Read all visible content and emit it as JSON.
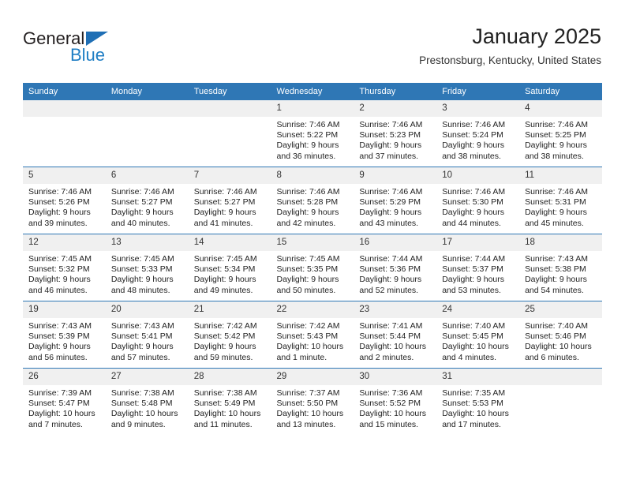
{
  "brand": {
    "name_part1": "General",
    "name_part2": "Blue",
    "logo_icon": "triangle-icon",
    "accent_color": "#1f7ec4"
  },
  "header": {
    "title": "January 2025",
    "subtitle": "Prestonsburg, Kentucky, United States"
  },
  "theme": {
    "header_bar_color": "#2f77b5",
    "daynum_bg": "#f0f0f0",
    "row_divider": "#2f77b5"
  },
  "calendar": {
    "weekday_headers": [
      "Sunday",
      "Monday",
      "Tuesday",
      "Wednesday",
      "Thursday",
      "Friday",
      "Saturday"
    ],
    "weeks": [
      [
        {
          "day": "",
          "sunrise": "",
          "sunset": "",
          "daylight1": "",
          "daylight2": ""
        },
        {
          "day": "",
          "sunrise": "",
          "sunset": "",
          "daylight1": "",
          "daylight2": ""
        },
        {
          "day": "",
          "sunrise": "",
          "sunset": "",
          "daylight1": "",
          "daylight2": ""
        },
        {
          "day": "1",
          "sunrise": "Sunrise: 7:46 AM",
          "sunset": "Sunset: 5:22 PM",
          "daylight1": "Daylight: 9 hours",
          "daylight2": "and 36 minutes."
        },
        {
          "day": "2",
          "sunrise": "Sunrise: 7:46 AM",
          "sunset": "Sunset: 5:23 PM",
          "daylight1": "Daylight: 9 hours",
          "daylight2": "and 37 minutes."
        },
        {
          "day": "3",
          "sunrise": "Sunrise: 7:46 AM",
          "sunset": "Sunset: 5:24 PM",
          "daylight1": "Daylight: 9 hours",
          "daylight2": "and 38 minutes."
        },
        {
          "day": "4",
          "sunrise": "Sunrise: 7:46 AM",
          "sunset": "Sunset: 5:25 PM",
          "daylight1": "Daylight: 9 hours",
          "daylight2": "and 38 minutes."
        }
      ],
      [
        {
          "day": "5",
          "sunrise": "Sunrise: 7:46 AM",
          "sunset": "Sunset: 5:26 PM",
          "daylight1": "Daylight: 9 hours",
          "daylight2": "and 39 minutes."
        },
        {
          "day": "6",
          "sunrise": "Sunrise: 7:46 AM",
          "sunset": "Sunset: 5:27 PM",
          "daylight1": "Daylight: 9 hours",
          "daylight2": "and 40 minutes."
        },
        {
          "day": "7",
          "sunrise": "Sunrise: 7:46 AM",
          "sunset": "Sunset: 5:27 PM",
          "daylight1": "Daylight: 9 hours",
          "daylight2": "and 41 minutes."
        },
        {
          "day": "8",
          "sunrise": "Sunrise: 7:46 AM",
          "sunset": "Sunset: 5:28 PM",
          "daylight1": "Daylight: 9 hours",
          "daylight2": "and 42 minutes."
        },
        {
          "day": "9",
          "sunrise": "Sunrise: 7:46 AM",
          "sunset": "Sunset: 5:29 PM",
          "daylight1": "Daylight: 9 hours",
          "daylight2": "and 43 minutes."
        },
        {
          "day": "10",
          "sunrise": "Sunrise: 7:46 AM",
          "sunset": "Sunset: 5:30 PM",
          "daylight1": "Daylight: 9 hours",
          "daylight2": "and 44 minutes."
        },
        {
          "day": "11",
          "sunrise": "Sunrise: 7:46 AM",
          "sunset": "Sunset: 5:31 PM",
          "daylight1": "Daylight: 9 hours",
          "daylight2": "and 45 minutes."
        }
      ],
      [
        {
          "day": "12",
          "sunrise": "Sunrise: 7:45 AM",
          "sunset": "Sunset: 5:32 PM",
          "daylight1": "Daylight: 9 hours",
          "daylight2": "and 46 minutes."
        },
        {
          "day": "13",
          "sunrise": "Sunrise: 7:45 AM",
          "sunset": "Sunset: 5:33 PM",
          "daylight1": "Daylight: 9 hours",
          "daylight2": "and 48 minutes."
        },
        {
          "day": "14",
          "sunrise": "Sunrise: 7:45 AM",
          "sunset": "Sunset: 5:34 PM",
          "daylight1": "Daylight: 9 hours",
          "daylight2": "and 49 minutes."
        },
        {
          "day": "15",
          "sunrise": "Sunrise: 7:45 AM",
          "sunset": "Sunset: 5:35 PM",
          "daylight1": "Daylight: 9 hours",
          "daylight2": "and 50 minutes."
        },
        {
          "day": "16",
          "sunrise": "Sunrise: 7:44 AM",
          "sunset": "Sunset: 5:36 PM",
          "daylight1": "Daylight: 9 hours",
          "daylight2": "and 52 minutes."
        },
        {
          "day": "17",
          "sunrise": "Sunrise: 7:44 AM",
          "sunset": "Sunset: 5:37 PM",
          "daylight1": "Daylight: 9 hours",
          "daylight2": "and 53 minutes."
        },
        {
          "day": "18",
          "sunrise": "Sunrise: 7:43 AM",
          "sunset": "Sunset: 5:38 PM",
          "daylight1": "Daylight: 9 hours",
          "daylight2": "and 54 minutes."
        }
      ],
      [
        {
          "day": "19",
          "sunrise": "Sunrise: 7:43 AM",
          "sunset": "Sunset: 5:39 PM",
          "daylight1": "Daylight: 9 hours",
          "daylight2": "and 56 minutes."
        },
        {
          "day": "20",
          "sunrise": "Sunrise: 7:43 AM",
          "sunset": "Sunset: 5:41 PM",
          "daylight1": "Daylight: 9 hours",
          "daylight2": "and 57 minutes."
        },
        {
          "day": "21",
          "sunrise": "Sunrise: 7:42 AM",
          "sunset": "Sunset: 5:42 PM",
          "daylight1": "Daylight: 9 hours",
          "daylight2": "and 59 minutes."
        },
        {
          "day": "22",
          "sunrise": "Sunrise: 7:42 AM",
          "sunset": "Sunset: 5:43 PM",
          "daylight1": "Daylight: 10 hours",
          "daylight2": "and 1 minute."
        },
        {
          "day": "23",
          "sunrise": "Sunrise: 7:41 AM",
          "sunset": "Sunset: 5:44 PM",
          "daylight1": "Daylight: 10 hours",
          "daylight2": "and 2 minutes."
        },
        {
          "day": "24",
          "sunrise": "Sunrise: 7:40 AM",
          "sunset": "Sunset: 5:45 PM",
          "daylight1": "Daylight: 10 hours",
          "daylight2": "and 4 minutes."
        },
        {
          "day": "25",
          "sunrise": "Sunrise: 7:40 AM",
          "sunset": "Sunset: 5:46 PM",
          "daylight1": "Daylight: 10 hours",
          "daylight2": "and 6 minutes."
        }
      ],
      [
        {
          "day": "26",
          "sunrise": "Sunrise: 7:39 AM",
          "sunset": "Sunset: 5:47 PM",
          "daylight1": "Daylight: 10 hours",
          "daylight2": "and 7 minutes."
        },
        {
          "day": "27",
          "sunrise": "Sunrise: 7:38 AM",
          "sunset": "Sunset: 5:48 PM",
          "daylight1": "Daylight: 10 hours",
          "daylight2": "and 9 minutes."
        },
        {
          "day": "28",
          "sunrise": "Sunrise: 7:38 AM",
          "sunset": "Sunset: 5:49 PM",
          "daylight1": "Daylight: 10 hours",
          "daylight2": "and 11 minutes."
        },
        {
          "day": "29",
          "sunrise": "Sunrise: 7:37 AM",
          "sunset": "Sunset: 5:50 PM",
          "daylight1": "Daylight: 10 hours",
          "daylight2": "and 13 minutes."
        },
        {
          "day": "30",
          "sunrise": "Sunrise: 7:36 AM",
          "sunset": "Sunset: 5:52 PM",
          "daylight1": "Daylight: 10 hours",
          "daylight2": "and 15 minutes."
        },
        {
          "day": "31",
          "sunrise": "Sunrise: 7:35 AM",
          "sunset": "Sunset: 5:53 PM",
          "daylight1": "Daylight: 10 hours",
          "daylight2": "and 17 minutes."
        },
        {
          "day": "",
          "sunrise": "",
          "sunset": "",
          "daylight1": "",
          "daylight2": ""
        }
      ]
    ]
  }
}
